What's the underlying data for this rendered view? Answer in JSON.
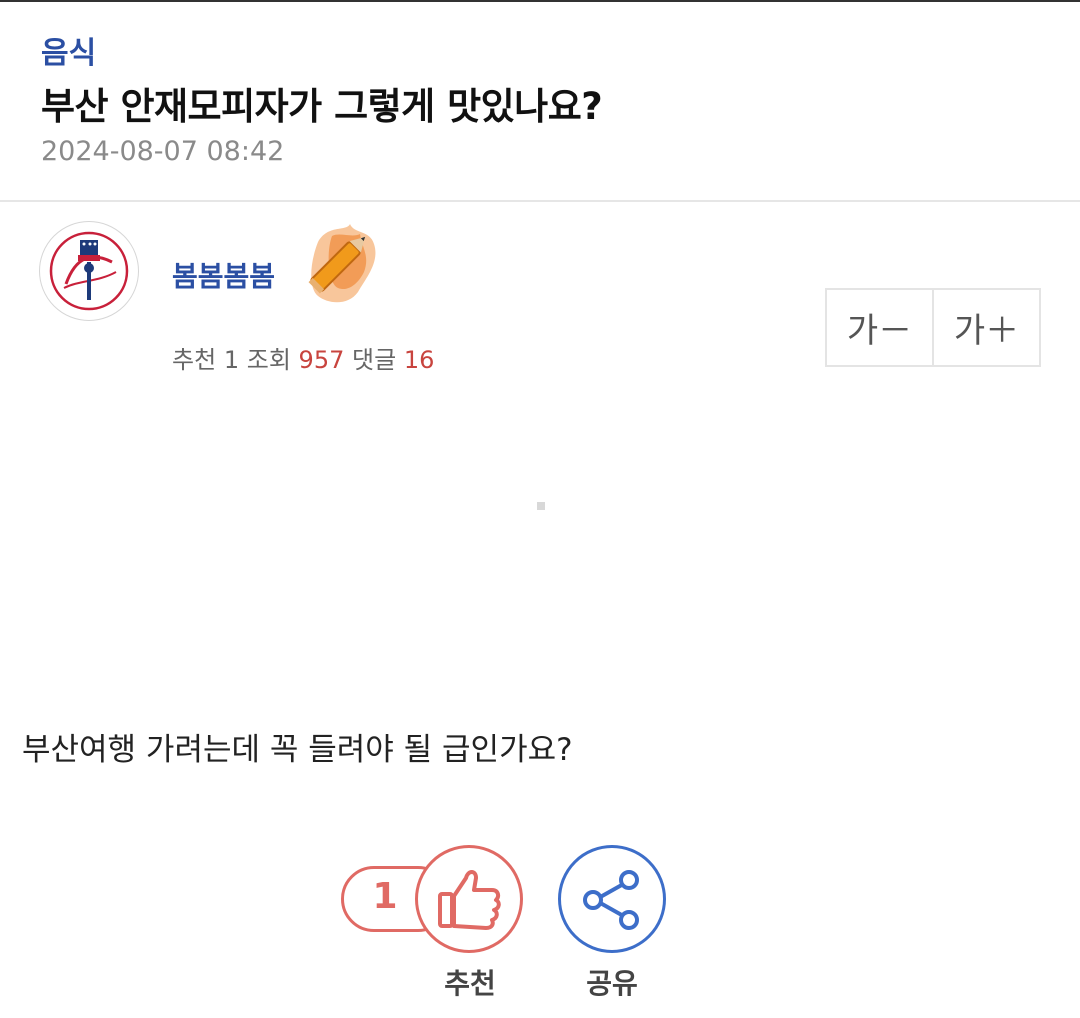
{
  "post": {
    "category": "음식",
    "title": "부산 안재모피자가 그렇게 맛있나요?",
    "date": "2024-08-07 08:42",
    "body": "부산여행 가려는데 꼭 들려야 될 급인가요?"
  },
  "author": {
    "nickname": "봄봄봄봄",
    "avatar_icon": "yankees-logo-icon",
    "level_icon": "flaming-pencil-icon"
  },
  "stats": {
    "recommend_label": "추천",
    "recommend_count": "1",
    "views_label": "조회",
    "views_count": "957",
    "comments_label": "댓글",
    "comments_count": "16"
  },
  "font_controls": {
    "decrease_label": "가－",
    "increase_label": "가＋"
  },
  "actions": {
    "recommend_count": "1",
    "recommend_label": "추천",
    "share_label": "공유"
  },
  "colors": {
    "accent_blue": "#2b4fa3",
    "recommend_red": "#e06a64",
    "share_blue": "#3d6ec9"
  }
}
